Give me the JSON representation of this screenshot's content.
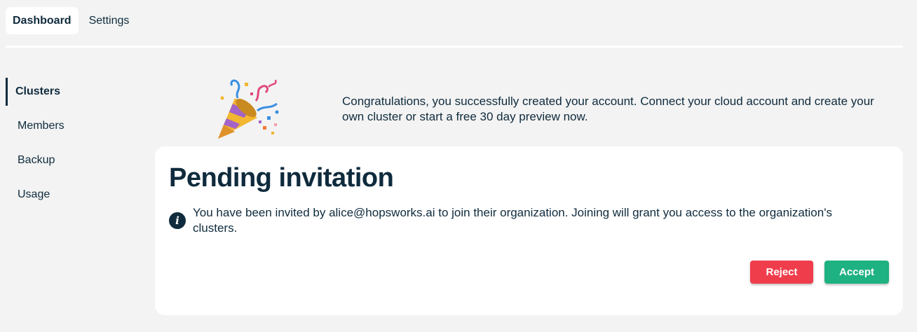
{
  "top_nav": {
    "tabs": [
      {
        "label": "Dashboard",
        "active": true
      },
      {
        "label": "Settings",
        "active": false
      }
    ]
  },
  "sidebar": {
    "items": [
      {
        "label": "Clusters",
        "active": true
      },
      {
        "label": "Members",
        "active": false
      },
      {
        "label": "Backup",
        "active": false
      },
      {
        "label": "Usage",
        "active": false
      }
    ]
  },
  "welcome": {
    "icon": "party-popper-icon",
    "message": "Congratulations, you successfully created your account. Connect your cloud account and create your own cluster or start a free 30 day preview now."
  },
  "invitation": {
    "title": "Pending invitation",
    "info_icon": "info-icon",
    "message": "You have been invited by alice@hopsworks.ai to join their organization. Joining will grant you access to the organization's clusters.",
    "reject_label": "Reject",
    "accept_label": "Accept"
  },
  "colors": {
    "background": "#f3f3f3",
    "text": "#0f2b3d",
    "reject": "#f03d4b",
    "accept": "#1eb182"
  }
}
